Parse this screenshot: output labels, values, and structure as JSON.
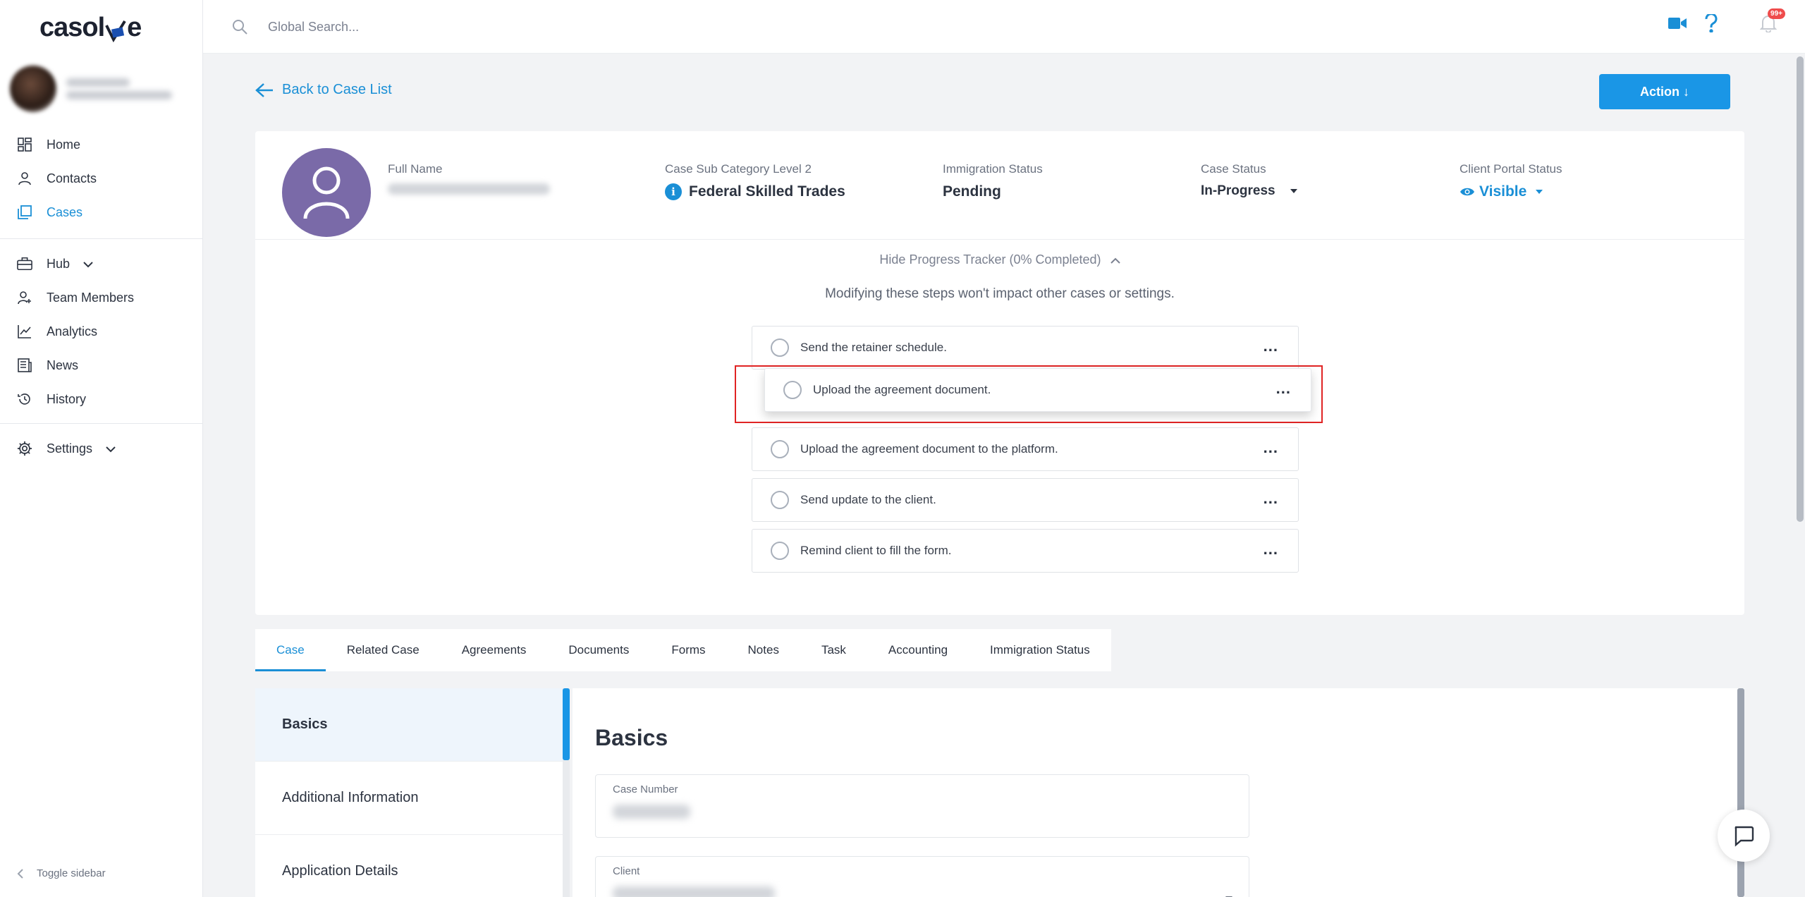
{
  "app": {
    "logo_text_a": "casol",
    "logo_text_b": "e"
  },
  "search": {
    "placeholder": "Global Search..."
  },
  "notifications": {
    "count": "99+"
  },
  "sidebar": {
    "items": [
      {
        "label": "Home",
        "icon": "grid-icon"
      },
      {
        "label": "Contacts",
        "icon": "user-icon"
      },
      {
        "label": "Cases",
        "icon": "cases-icon",
        "active": true
      },
      {
        "label": "Hub",
        "icon": "briefcase-icon"
      },
      {
        "label": "Team Members",
        "icon": "user-plus-icon"
      },
      {
        "label": "Analytics",
        "icon": "analytics-icon"
      },
      {
        "label": "News",
        "icon": "news-icon"
      },
      {
        "label": "History",
        "icon": "history-icon"
      },
      {
        "label": "Settings",
        "icon": "gear-icon"
      }
    ],
    "toggle_label": "Toggle sidebar"
  },
  "main": {
    "back_label": "Back to Case List",
    "action_label": "Action ↓",
    "profile": {
      "full_name_label": "Full Name",
      "sub_category_label": "Case Sub Category Level 2",
      "sub_category_value": "Federal Skilled Trades",
      "immigration_label": "Immigration Status",
      "immigration_value": "Pending",
      "case_status_label": "Case Status",
      "case_status_value": "In-Progress",
      "portal_label": "Client Portal Status",
      "portal_value": "Visible"
    },
    "tracker": {
      "toggle_label": "Hide Progress Tracker (0% Completed)",
      "note": "Modifying these steps won't impact other cases or settings.",
      "steps": [
        "Send the retainer schedule.",
        "Upload the agreement document.",
        "Upload the agreement document to the platform.",
        "Send update to the client.",
        "Remind client to fill the form."
      ],
      "more_label": "..."
    },
    "tabs": [
      "Case",
      "Related Case",
      "Agreements",
      "Documents",
      "Forms",
      "Notes",
      "Task",
      "Accounting",
      "Immigration Status"
    ],
    "left_panel": [
      "Basics",
      "Additional Information",
      "Application Details"
    ],
    "section_title": "Basics",
    "fields": {
      "case_number_label": "Case Number",
      "client_label": "Client"
    }
  },
  "colors": {
    "accent": "#1a8fd6",
    "button": "#1a96e6",
    "highlight": "#e02424",
    "avatar": "#7a6aa8"
  }
}
